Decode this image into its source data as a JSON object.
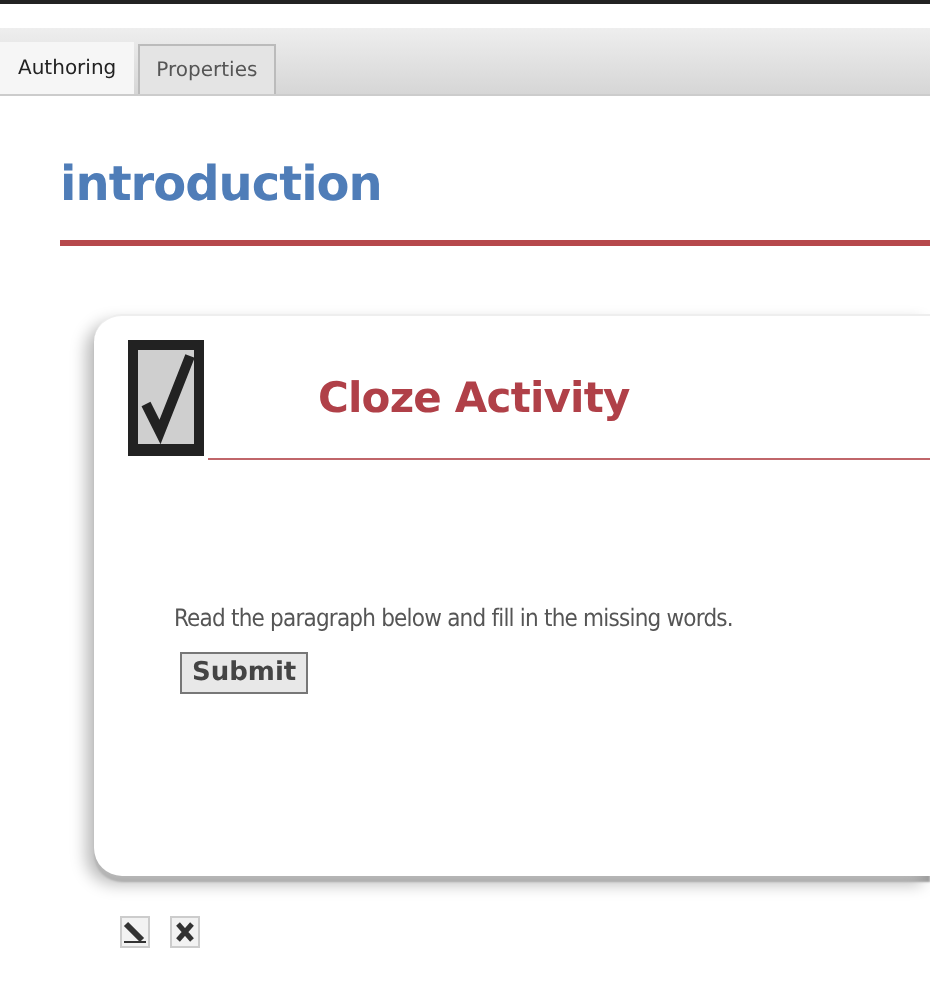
{
  "tabs": [
    {
      "label": "Authoring",
      "selected": true
    },
    {
      "label": "Properties",
      "selected": false
    }
  ],
  "page": {
    "title": "introduction"
  },
  "activity": {
    "title": "Cloze Activity",
    "instructions": "Read the paragraph below and fill in the missing words.",
    "submit_button": "Submit"
  }
}
